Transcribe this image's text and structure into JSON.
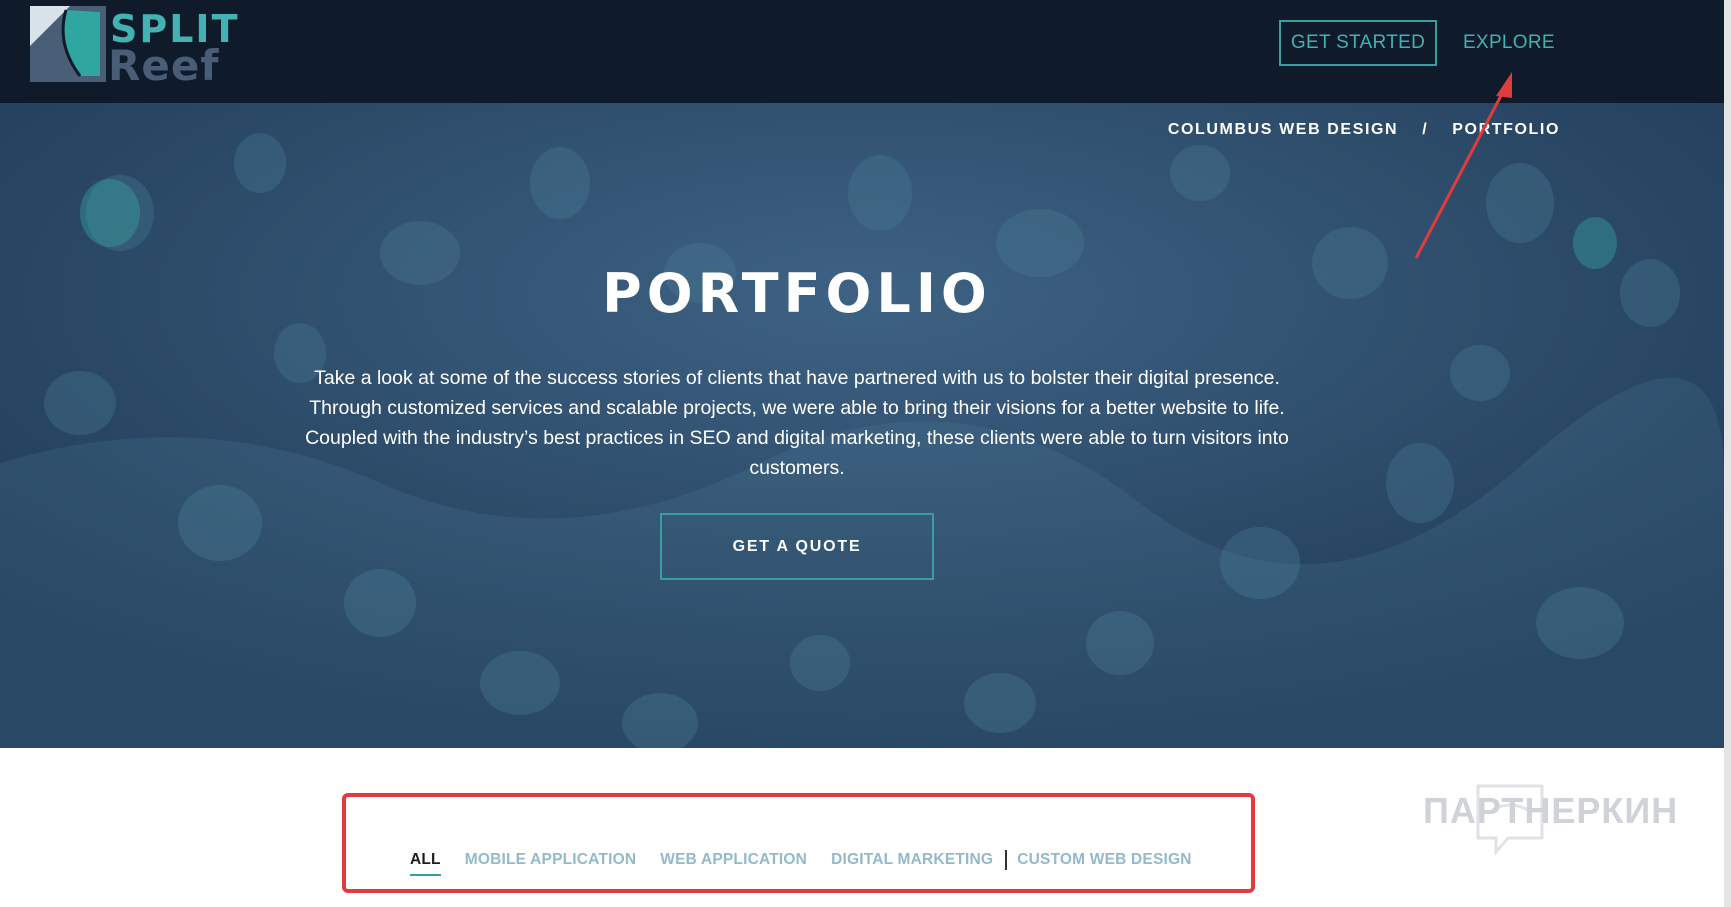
{
  "header": {
    "logo_text": [
      "SPLIT",
      "Reef"
    ],
    "get_started_label": "GET STARTED",
    "explore_label": "EXPLORE"
  },
  "breadcrumb": {
    "items": [
      "COLUMBUS WEB DESIGN",
      "PORTFOLIO"
    ],
    "separator": "/"
  },
  "hero": {
    "title": "PORTFOLIO",
    "description": "Take a look at some of the success stories of clients that have partnered with us to bolster their digital presence. Through customized services and scalable projects, we were able to bring their visions for a better website to life. Coupled with the industry’s best practices in SEO and digital marketing, these clients were able to turn visitors into customers.",
    "cta_label": "GET A QUOTE"
  },
  "filters": {
    "items": [
      "ALL",
      "MOBILE APPLICATION",
      "WEB APPLICATION",
      "DIGITAL MARKETING",
      "CUSTOM WEB DESIGN"
    ],
    "active": "ALL"
  },
  "watermark": {
    "text": "ПАРТНЕРКИН"
  },
  "colors": {
    "nav_bg": "#0f1b2b",
    "accent": "#45b0b3",
    "hero_bg": "#2b4765",
    "annotation": "#e03c3c"
  }
}
